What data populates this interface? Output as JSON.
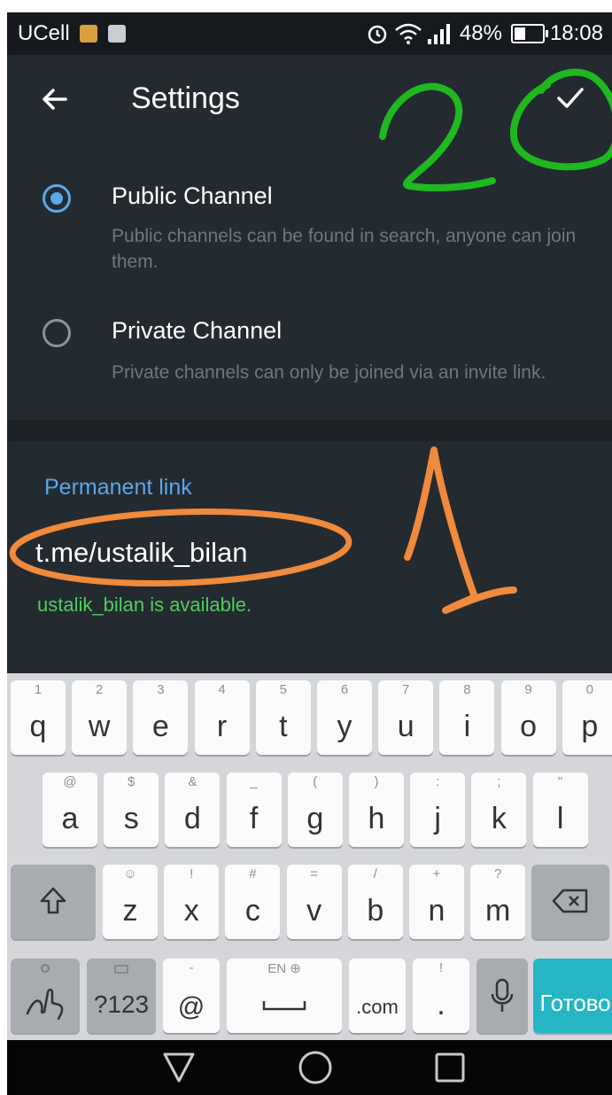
{
  "status_bar": {
    "carrier": "UCell",
    "battery_percent": "48%",
    "battery_level": 0.48,
    "time": "18:08",
    "icons": [
      "keyboard-notification-icon",
      "image-notification-icon",
      "alarm-icon",
      "wifi-icon",
      "signal-icon",
      "battery-icon"
    ]
  },
  "app_bar": {
    "title": "Settings",
    "back_icon": "arrow-back-icon",
    "confirm_icon": "checkmark-icon"
  },
  "channel_type": {
    "selected": "public",
    "options": [
      {
        "label": "Public Channel",
        "description": "Public channels can be found in search, anyone can join them.",
        "selected": true
      },
      {
        "label": "Private Channel",
        "description": "Private channels can only be joined via an invite link.",
        "selected": false
      }
    ]
  },
  "permanent_link": {
    "label": "Permanent link",
    "value": "t.me/ustalik_bilan",
    "status": "ustalik_bilan is available."
  },
  "annotations": {
    "step_1": "1",
    "step_2": "2",
    "colors": {
      "green": "#1fb81f",
      "orange": "#f08a3c"
    }
  },
  "keyboard": {
    "row1": [
      {
        "main": "q",
        "sec": "1"
      },
      {
        "main": "w",
        "sec": "2"
      },
      {
        "main": "e",
        "sec": "3"
      },
      {
        "main": "r",
        "sec": "4"
      },
      {
        "main": "t",
        "sec": "5"
      },
      {
        "main": "y",
        "sec": "6"
      },
      {
        "main": "u",
        "sec": "7"
      },
      {
        "main": "i",
        "sec": "8"
      },
      {
        "main": "o",
        "sec": "9"
      },
      {
        "main": "p",
        "sec": "0"
      }
    ],
    "row2": [
      {
        "main": "a",
        "sec": "@"
      },
      {
        "main": "s",
        "sec": "$"
      },
      {
        "main": "d",
        "sec": "&"
      },
      {
        "main": "f",
        "sec": "_"
      },
      {
        "main": "g",
        "sec": "("
      },
      {
        "main": "h",
        "sec": ")"
      },
      {
        "main": "j",
        "sec": ":"
      },
      {
        "main": "k",
        "sec": ";"
      },
      {
        "main": "l",
        "sec": "\""
      }
    ],
    "row3": [
      {
        "main": "z",
        "sec": "☺"
      },
      {
        "main": "x",
        "sec": "!"
      },
      {
        "main": "c",
        "sec": "#"
      },
      {
        "main": "v",
        "sec": "="
      },
      {
        "main": "b",
        "sec": "/"
      },
      {
        "main": "n",
        "sec": "+"
      },
      {
        "main": "m",
        "sec": "?"
      }
    ],
    "symbols_key": "?123",
    "at_key": "@",
    "at_sec": "-",
    "space_sec": "EN ⊕",
    "dotcom_key": ".com",
    "period_key": ".",
    "period_sec": "!",
    "done_key": "Готово",
    "shift_icon": "shift-icon",
    "backspace_icon": "backspace-icon",
    "mic_icon": "microphone-icon",
    "swipe_icon": "swipe-gesture-icon",
    "settings_icon": "gear-icon"
  },
  "nav_bar": {
    "icons": [
      "back-triangle-icon",
      "home-circle-icon",
      "recents-square-icon"
    ]
  }
}
